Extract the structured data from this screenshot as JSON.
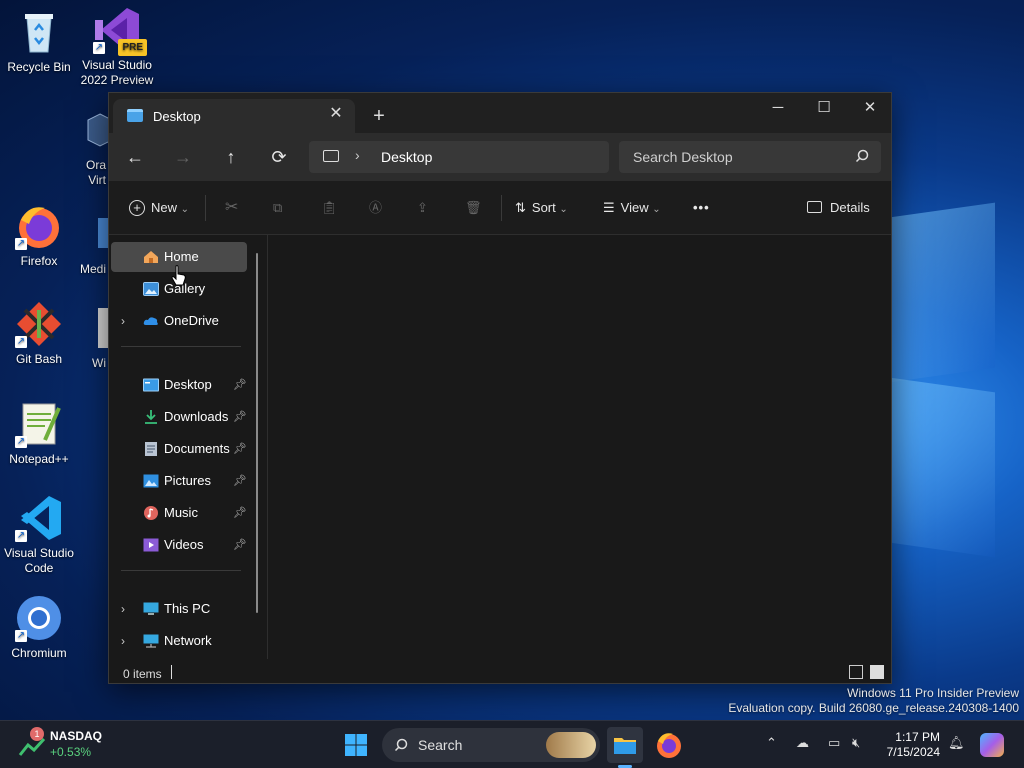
{
  "desktop": {
    "icons": [
      {
        "label": "Recycle Bin"
      },
      {
        "label": "Visual Studio 2022 Preview",
        "badge": "PRE"
      },
      {
        "label": "Ora Virt"
      },
      {
        "label": "Firefox"
      },
      {
        "label": "Medi"
      },
      {
        "label": "Git Bash"
      },
      {
        "label": "Wi"
      },
      {
        "label": "Notepad++"
      },
      {
        "label": "Visual Studio Code"
      },
      {
        "label": "Chromium"
      }
    ]
  },
  "window": {
    "tab_title": "Desktop",
    "nav": {
      "back": "←",
      "forward": "→",
      "up": "↑",
      "refresh": "⟳"
    },
    "address": {
      "path": "Desktop"
    },
    "search": {
      "placeholder": "Search Desktop"
    },
    "commands": {
      "new": "New",
      "sort": "Sort",
      "view": "View",
      "more": "•••",
      "details": "Details"
    },
    "sidebar": {
      "items": [
        {
          "label": "Home"
        },
        {
          "label": "Gallery"
        },
        {
          "label": "OneDrive"
        },
        {
          "label": "Desktop"
        },
        {
          "label": "Downloads"
        },
        {
          "label": "Documents"
        },
        {
          "label": "Pictures"
        },
        {
          "label": "Music"
        },
        {
          "label": "Videos"
        },
        {
          "label": "This PC"
        },
        {
          "label": "Network"
        }
      ]
    },
    "status": {
      "items": "0 items"
    }
  },
  "watermark": {
    "line1": "Windows 11 Pro Insider Preview",
    "line2": "Evaluation copy. Build 26080.ge_release.240308-1400"
  },
  "taskbar": {
    "widget": {
      "name": "NASDAQ",
      "change": "+0.53%",
      "badge": "1"
    },
    "search_label": "Search",
    "time": "1:17 PM",
    "date": "7/15/2024"
  },
  "colors": {
    "accent": "#4aa3e8",
    "window_bg": "#191919",
    "selected": "#4a4a4a"
  }
}
